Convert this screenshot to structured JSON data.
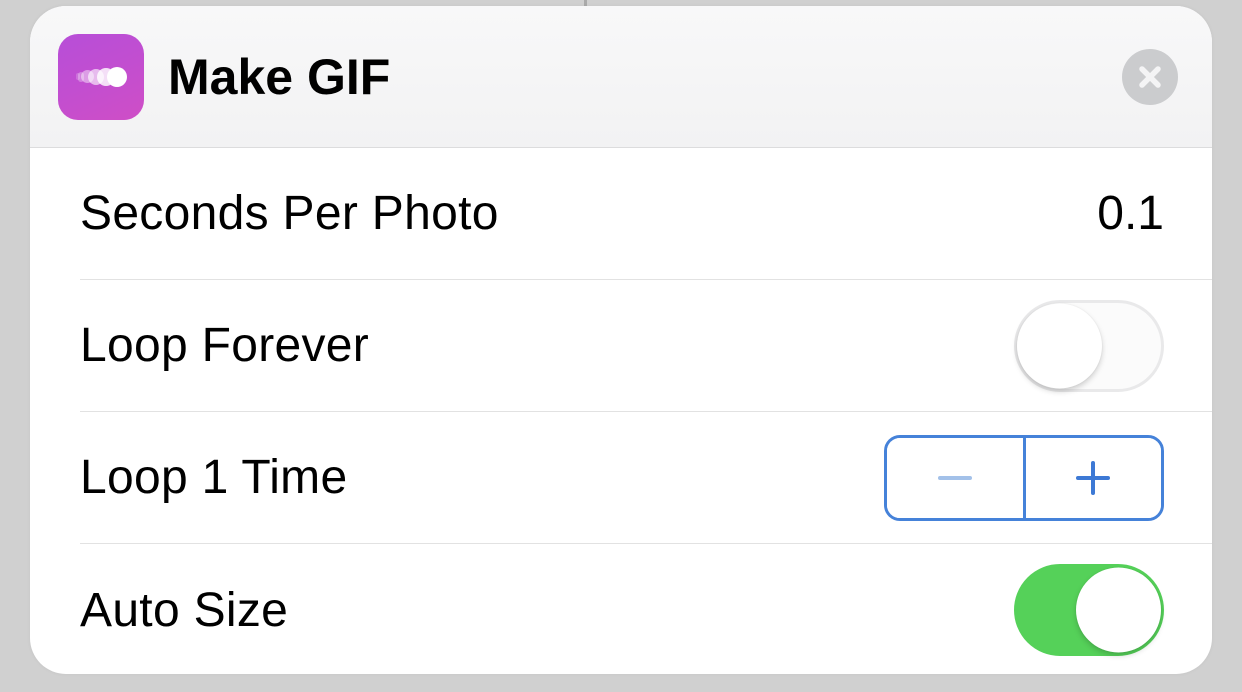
{
  "header": {
    "title": "Make GIF",
    "icon": "motion-trail-icon",
    "accent_color": "#c24fcf"
  },
  "rows": {
    "seconds_per_photo": {
      "label": "Seconds Per Photo",
      "value": "0.1"
    },
    "loop_forever": {
      "label": "Loop Forever",
      "on": false
    },
    "loop_times": {
      "label": "Loop 1 Time",
      "count": 1
    },
    "auto_size": {
      "label": "Auto Size",
      "on": true
    }
  },
  "colors": {
    "toggle_on": "#55d159",
    "stepper_border": "#4582d9"
  }
}
